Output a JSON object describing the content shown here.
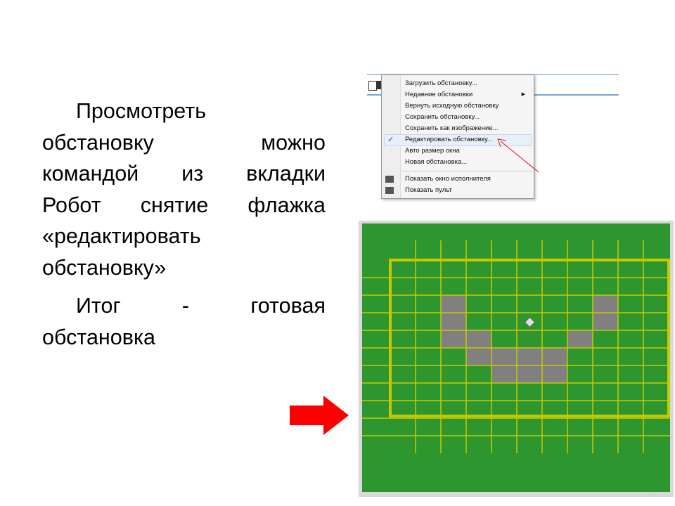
{
  "text": {
    "para1_lines": [
      "Просмотреть",
      "обстановку можно",
      "командой из вкладки",
      "Робот снятие флажка",
      "«редактировать",
      "обстановку»"
    ],
    "para2_lines": [
      "Итог - готовая",
      "обстановка"
    ]
  },
  "menu": {
    "items": [
      {
        "label": "Загрузить обстановку...",
        "checked": false,
        "submenu": false
      },
      {
        "label": "Недавние обстановки",
        "checked": false,
        "submenu": true
      },
      {
        "label": "Вернуть исходную обстановку",
        "checked": false,
        "submenu": false
      },
      {
        "label": "Сохранить обстановку...",
        "checked": false,
        "submenu": false
      },
      {
        "label": "Сохранить как изображение...",
        "checked": false,
        "submenu": false
      },
      {
        "label": "Редактировать обстановку...",
        "checked": true,
        "submenu": false
      },
      {
        "label": "Авто размер окна",
        "checked": false,
        "submenu": false
      },
      {
        "label": "Новая обстановка...",
        "checked": false,
        "submenu": false
      },
      {
        "label": "Показать окно исполнителя",
        "checked": false,
        "submenu": false,
        "icon": "grid-icon"
      },
      {
        "label": "Показать пульт",
        "checked": false,
        "submenu": false,
        "icon": "remote-icon"
      }
    ],
    "check_glyph": "✓",
    "submenu_glyph": "▶"
  },
  "robot_field": {
    "cols": 11,
    "rows": 11,
    "painted_cells": [
      [
        3,
        3
      ],
      [
        9,
        3
      ],
      [
        3,
        4
      ],
      [
        9,
        4
      ],
      [
        3,
        5
      ],
      [
        4,
        5
      ],
      [
        8,
        5
      ],
      [
        4,
        6
      ],
      [
        5,
        6
      ],
      [
        6,
        6
      ],
      [
        7,
        6
      ],
      [
        5,
        7
      ],
      [
        6,
        7
      ],
      [
        7,
        7
      ]
    ],
    "robot_cell": [
      6,
      4
    ],
    "colors": {
      "field": "#2e962e",
      "grid": "#c8c800",
      "wall": "#c8c800",
      "paint": "#808080"
    }
  },
  "colors": {
    "arrow": "#ff0000",
    "annotation": "#d81b1b"
  }
}
